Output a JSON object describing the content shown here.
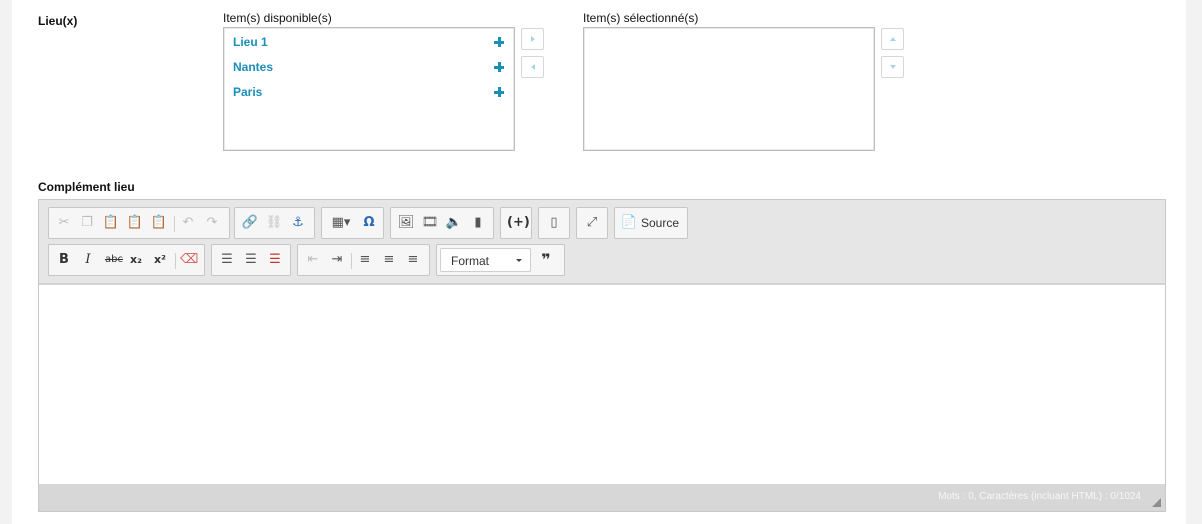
{
  "location": {
    "label": "Lieu(x)",
    "available_title": "Item(s) disponible(s)",
    "selected_title": "Item(s) sélectionné(s)",
    "available_items": [
      {
        "label": "Lieu 1"
      },
      {
        "label": "Nantes"
      },
      {
        "label": "Paris"
      }
    ],
    "selected_items": []
  },
  "complement": {
    "label": "Complément lieu"
  },
  "editor": {
    "source_label": "Source",
    "format_label": "Format",
    "status": "Mots : 0, Caractères (incluant HTML) : 0/1024"
  },
  "colors": {
    "accent": "#1a8fb8",
    "arrow": "#a9d4e2"
  }
}
